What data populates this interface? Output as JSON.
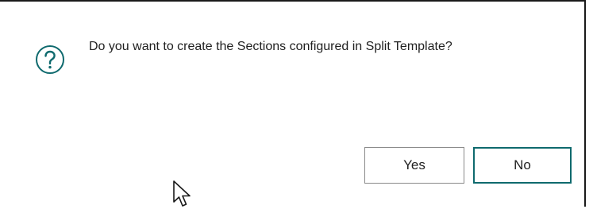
{
  "dialog": {
    "icon": "question-circle-icon",
    "accent_color": "#0f6a6e",
    "message": "Do you want to create the Sections configured in Split Template?",
    "buttons": {
      "yes_label": "Yes",
      "no_label": "No"
    },
    "focused_button": "No"
  },
  "cursor": {
    "icon": "mouse-pointer-icon"
  }
}
